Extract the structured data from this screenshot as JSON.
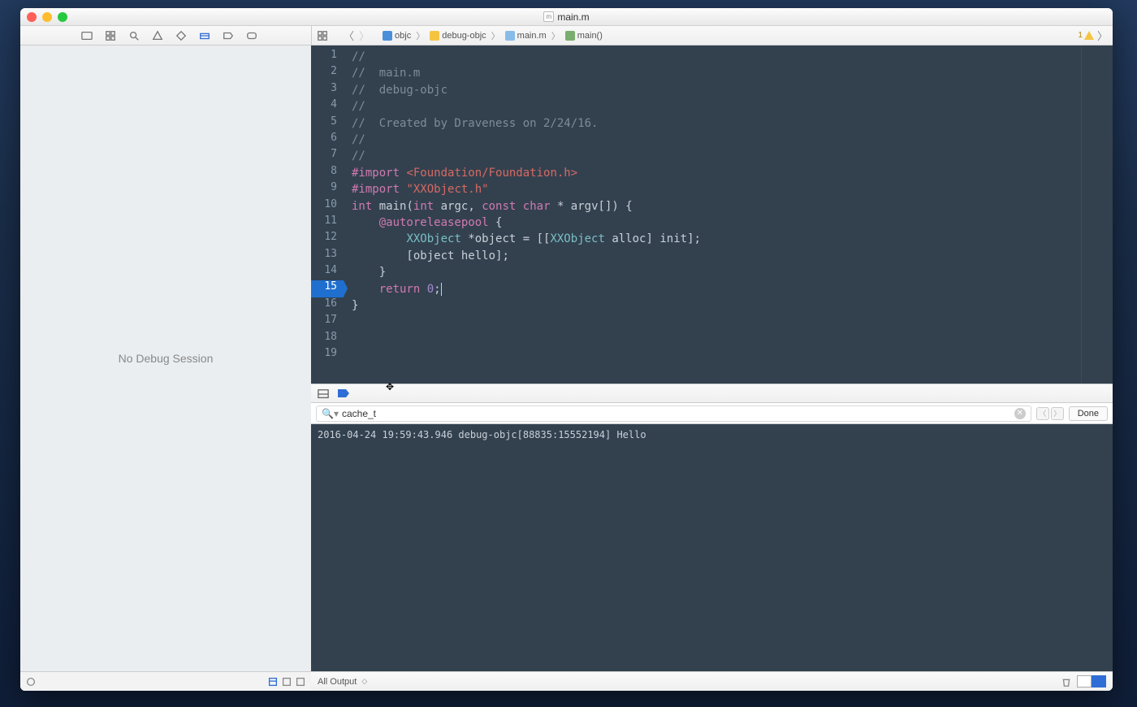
{
  "titlebar": {
    "filename": "main.m"
  },
  "breadcrumb": {
    "items": [
      {
        "label": "objc",
        "icon": "blue"
      },
      {
        "label": "debug-objc",
        "icon": "yellow"
      },
      {
        "label": "main.m",
        "icon": "file"
      },
      {
        "label": "main()",
        "icon": "func"
      }
    ]
  },
  "warnings": {
    "count": "1"
  },
  "sidebar": {
    "empty_label": "No Debug Session"
  },
  "editor": {
    "breakpoint_line": 15,
    "lines": [
      {
        "n": 1,
        "segs": [
          {
            "t": "//",
            "c": "cm"
          }
        ]
      },
      {
        "n": 2,
        "segs": [
          {
            "t": "//  main.m",
            "c": "cm"
          }
        ]
      },
      {
        "n": 3,
        "segs": [
          {
            "t": "//  debug-objc",
            "c": "cm"
          }
        ]
      },
      {
        "n": 4,
        "segs": [
          {
            "t": "//",
            "c": "cm"
          }
        ]
      },
      {
        "n": 5,
        "segs": [
          {
            "t": "//  Created by Draveness on 2/24/16.",
            "c": "cm"
          }
        ]
      },
      {
        "n": 6,
        "segs": [
          {
            "t": "//",
            "c": "cm"
          }
        ]
      },
      {
        "n": 7,
        "segs": [
          {
            "t": "//",
            "c": "cm"
          }
        ]
      },
      {
        "n": 8,
        "segs": []
      },
      {
        "n": 9,
        "segs": [
          {
            "t": "#import ",
            "c": "pp"
          },
          {
            "t": "<Foundation/Foundation.h>",
            "c": "hdr"
          }
        ]
      },
      {
        "n": 10,
        "segs": [
          {
            "t": "#import ",
            "c": "pp"
          },
          {
            "t": "\"XXObject.h\"",
            "c": "str"
          }
        ]
      },
      {
        "n": 11,
        "segs": []
      },
      {
        "n": 12,
        "segs": [
          {
            "t": "int",
            "c": "kw"
          },
          {
            "t": " ",
            "c": ""
          },
          {
            "t": "main",
            "c": "fn-name"
          },
          {
            "t": "(",
            "c": ""
          },
          {
            "t": "int",
            "c": "kw"
          },
          {
            "t": " argc, ",
            "c": ""
          },
          {
            "t": "const",
            "c": "kw"
          },
          {
            "t": " ",
            "c": ""
          },
          {
            "t": "char",
            "c": "kw"
          },
          {
            "t": " * argv[]) {",
            "c": ""
          }
        ]
      },
      {
        "n": 13,
        "segs": [
          {
            "t": "    ",
            "c": ""
          },
          {
            "t": "@autoreleasepool",
            "c": "obj-kw"
          },
          {
            "t": " {",
            "c": ""
          }
        ]
      },
      {
        "n": 14,
        "segs": [
          {
            "t": "        ",
            "c": ""
          },
          {
            "t": "XXObject",
            "c": "typ"
          },
          {
            "t": " *object = [[",
            "c": ""
          },
          {
            "t": "XXObject",
            "c": "typ"
          },
          {
            "t": " ",
            "c": ""
          },
          {
            "t": "alloc",
            "c": "fn-name"
          },
          {
            "t": "] ",
            "c": ""
          },
          {
            "t": "init",
            "c": "fn-name"
          },
          {
            "t": "];",
            "c": ""
          }
        ]
      },
      {
        "n": 15,
        "segs": [
          {
            "t": "        [object ",
            "c": ""
          },
          {
            "t": "hello",
            "c": "fn-name"
          },
          {
            "t": "];",
            "c": ""
          }
        ]
      },
      {
        "n": 16,
        "segs": [
          {
            "t": "    }",
            "c": ""
          }
        ]
      },
      {
        "n": 17,
        "segs": [
          {
            "t": "    ",
            "c": ""
          },
          {
            "t": "return",
            "c": "kw"
          },
          {
            "t": " ",
            "c": ""
          },
          {
            "t": "0",
            "c": "num"
          },
          {
            "t": ";",
            "c": ""
          }
        ]
      },
      {
        "n": 18,
        "segs": [
          {
            "t": "}",
            "c": ""
          }
        ]
      },
      {
        "n": 19,
        "segs": []
      }
    ]
  },
  "search": {
    "value": "cache_t",
    "done_label": "Done"
  },
  "console": {
    "output": "2016-04-24 19:59:43.946 debug-objc[88835:15552194] Hello"
  },
  "bottom": {
    "output_filter": "All Output"
  }
}
